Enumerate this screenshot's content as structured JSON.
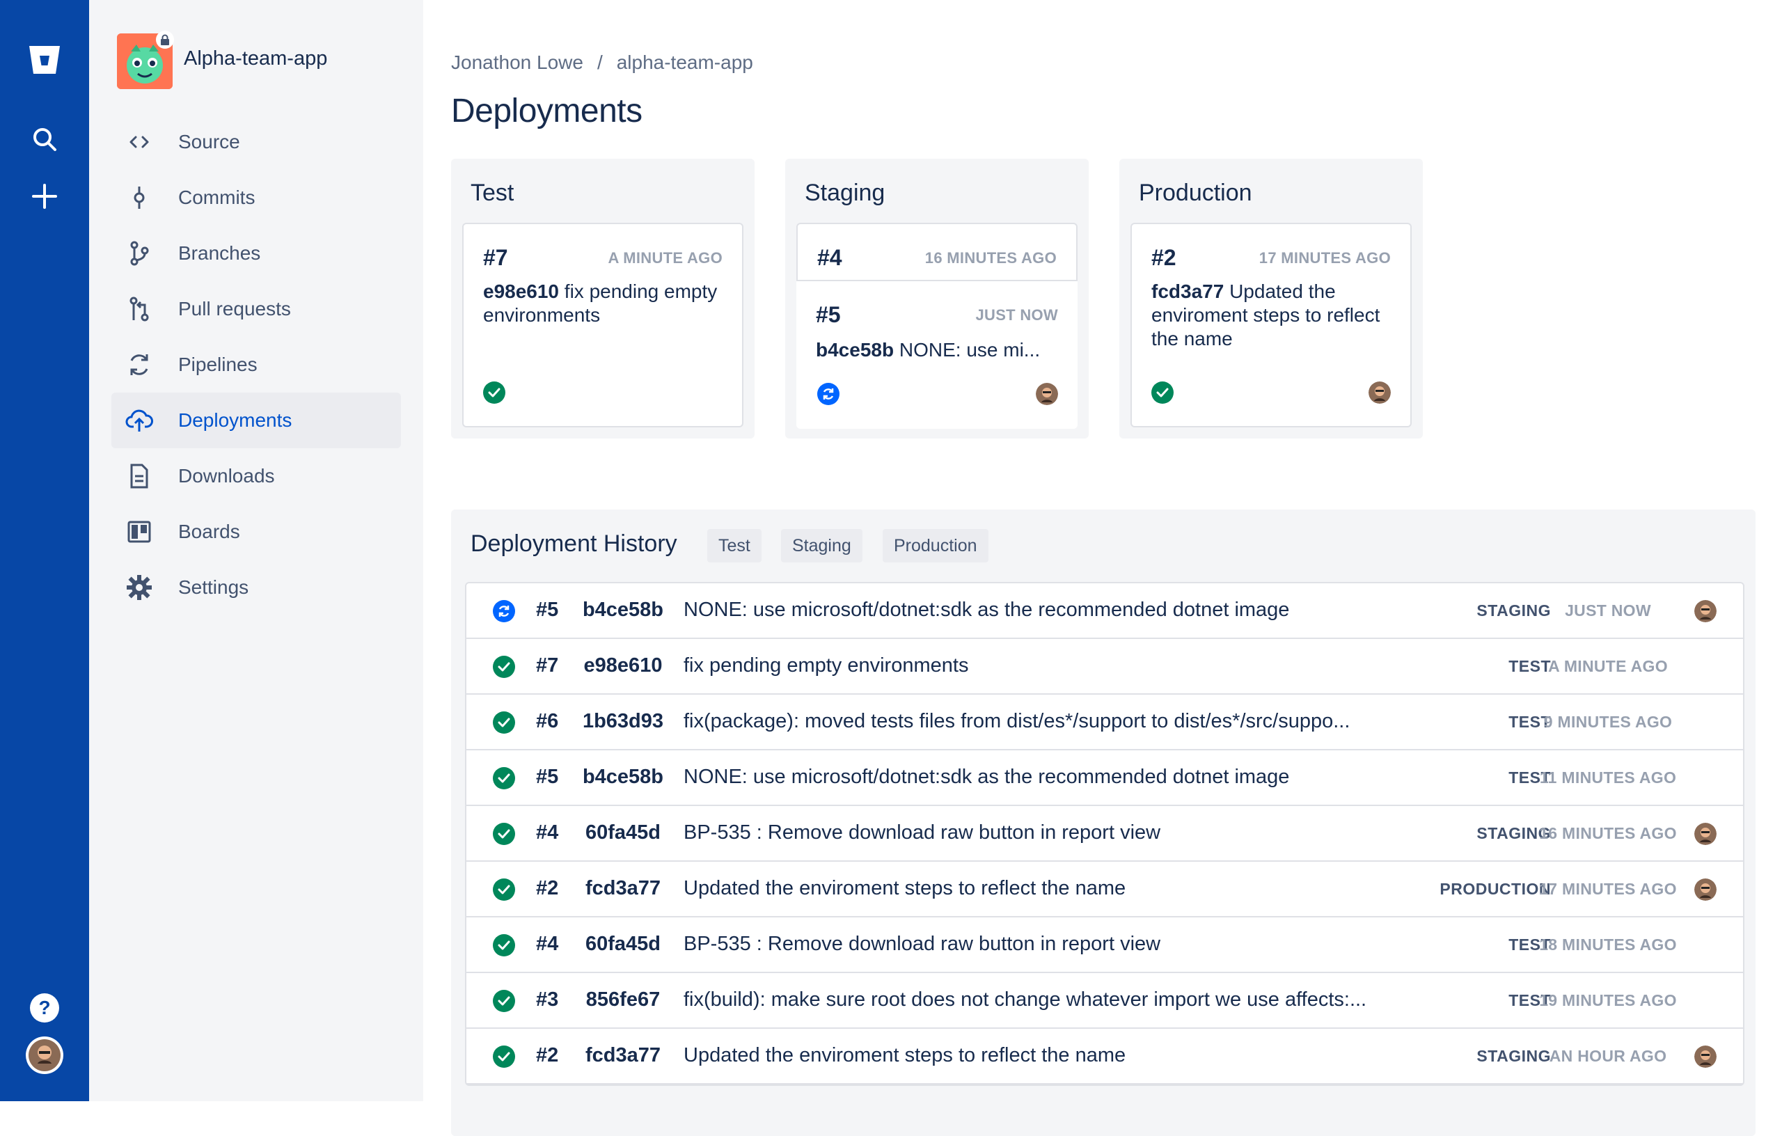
{
  "global_nav": {
    "logo_icon": "bitbucket-logo-icon",
    "search_icon": "search-icon",
    "create_icon": "plus-icon",
    "help_icon": "help-icon",
    "colors": {
      "background": "#0747a6"
    }
  },
  "project": {
    "name": "Alpha-team-app",
    "private_icon": "lock-icon"
  },
  "sidebar": {
    "items": [
      {
        "label": "Source",
        "icon": "code-icon"
      },
      {
        "label": "Commits",
        "icon": "commit-icon"
      },
      {
        "label": "Branches",
        "icon": "branch-icon"
      },
      {
        "label": "Pull requests",
        "icon": "pull-request-icon"
      },
      {
        "label": "Pipelines",
        "icon": "pipelines-icon"
      },
      {
        "label": "Deployments",
        "icon": "cloud-upload-icon",
        "active": true
      },
      {
        "label": "Downloads",
        "icon": "document-icon"
      },
      {
        "label": "Boards",
        "icon": "board-icon"
      },
      {
        "label": "Settings",
        "icon": "gear-icon"
      }
    ]
  },
  "breadcrumb": {
    "owner": "Jonathon Lowe",
    "separator": "/",
    "repo": "alpha-team-app"
  },
  "page_title": "Deployments",
  "environments": [
    {
      "name": "Test",
      "cards": [
        {
          "number": "#7",
          "time": "A MINUTE AGO",
          "hash": "e98e610",
          "message": "fix pending empty environments",
          "status": "success"
        }
      ]
    },
    {
      "name": "Staging",
      "cards": [
        {
          "number": "#4",
          "time": "16 MINUTES AGO"
        },
        {
          "number": "#5",
          "time": "JUST NOW",
          "hash": "b4ce58b",
          "message": "NONE: use mi...",
          "status": "in-progress"
        }
      ]
    },
    {
      "name": "Production",
      "cards": [
        {
          "number": "#2",
          "time": "17 MINUTES AGO",
          "hash": "fcd3a77",
          "message": "Updated the enviroment steps to reflect the name",
          "status": "success"
        }
      ]
    }
  ],
  "history": {
    "title": "Deployment History",
    "filters": [
      "Test",
      "Staging",
      "Production"
    ],
    "rows": [
      {
        "status": "in-progress",
        "number": "#5",
        "hash": "b4ce58b",
        "message": "NONE: use microsoft/dotnet:sdk as the recommended dotnet image",
        "env": "STAGING",
        "time": "JUST NOW",
        "avatar": true
      },
      {
        "status": "success",
        "number": "#7",
        "hash": "e98e610",
        "message": "fix pending empty environments",
        "env": "TEST",
        "time": "A MINUTE AGO",
        "avatar": false
      },
      {
        "status": "success",
        "number": "#6",
        "hash": "1b63d93",
        "message": "fix(package): moved tests files from dist/es*/support to dist/es*/src/suppo...",
        "env": "TEST",
        "time": "9 MINUTES AGO",
        "avatar": false
      },
      {
        "status": "success",
        "number": "#5",
        "hash": "b4ce58b",
        "message": "NONE: use microsoft/dotnet:sdk as the recommended dotnet image",
        "env": "TEST",
        "time": "11 MINUTES AGO",
        "avatar": false
      },
      {
        "status": "success",
        "number": "#4",
        "hash": "60fa45d",
        "message": "BP-535 : Remove download raw button in report view",
        "env": "STAGING",
        "time": "16 MINUTES AGO",
        "avatar": true
      },
      {
        "status": "success",
        "number": "#2",
        "hash": "fcd3a77",
        "message": "Updated the enviroment steps to reflect the name",
        "env": "PRODUCTION",
        "time": "17 MINUTES AGO",
        "avatar": true
      },
      {
        "status": "success",
        "number": "#4",
        "hash": "60fa45d",
        "message": "BP-535 : Remove download raw button in report view",
        "env": "TEST",
        "time": "18 MINUTES AGO",
        "avatar": false
      },
      {
        "status": "success",
        "number": "#3",
        "hash": "856fe67",
        "message": "fix(build): make sure root does not change whatever import we use affects:...",
        "env": "TEST",
        "time": "19 MINUTES AGO",
        "avatar": false
      },
      {
        "status": "success",
        "number": "#2",
        "hash": "fcd3a77",
        "message": "Updated the enviroment steps to reflect the name",
        "env": "STAGING",
        "time": "AN HOUR AGO",
        "avatar": true
      }
    ]
  }
}
